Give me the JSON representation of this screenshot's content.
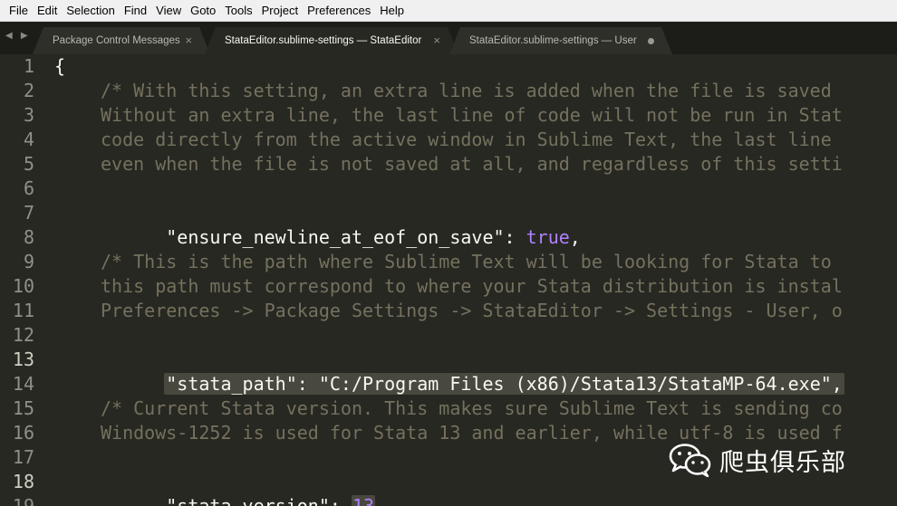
{
  "menu": [
    "File",
    "Edit",
    "Selection",
    "Find",
    "View",
    "Goto",
    "Tools",
    "Project",
    "Preferences",
    "Help"
  ],
  "tabs": [
    {
      "label": "Package Control Messages",
      "close": "×"
    },
    {
      "label": "StataEditor.sublime-settings — StataEditor",
      "close": "×"
    },
    {
      "label": "StataEditor.sublime-settings — User"
    }
  ],
  "nav_arrows": "◀ ▶",
  "line_numbers": [
    "1",
    "2",
    "3",
    "4",
    "5",
    "6",
    "7",
    "8",
    "9",
    "10",
    "11",
    "12",
    "13",
    "14",
    "15",
    "16",
    "17",
    "18",
    "19"
  ],
  "code": {
    "l1": "{",
    "l2": "/* With this setting, an extra line is added when the file is saved",
    "l3": "Without an extra line, the last line of code will not be run in Stat",
    "l4": "code directly from the active window in Sublime Text, the last line",
    "l5": "even when the file is not saved at all, and regardless of this setti",
    "l7_key": "\"ensure_newline_at_eof_on_save\"",
    "l7_sep": ": ",
    "l7_val": "true",
    "l7_end": ",",
    "l9": "/* This is the path where Sublime Text will be looking for Stata to",
    "l10": "this path must correspond to where your Stata distribution is instal",
    "l11": "Preferences -> Package Settings -> StataEditor -> Settings - User, o",
    "l13_key": "\"stata_path\"",
    "l13_sep": ": ",
    "l13_val": "\"C:/Program Files (x86)/Stata13/StataMP-64.exe\"",
    "l13_end": ",",
    "l15": "/* Current Stata version. This makes sure Sublime Text is sending co",
    "l16": "Windows-1252 is used for Stata 13 and earlier, while utf-8 is used f",
    "l18_key": "\"stata_version\"",
    "l18_sep": ": ",
    "l18_val": "13",
    "l18_end": ","
  },
  "watermark": {
    "text": "爬虫俱乐部",
    "icon": "wechat-icon"
  },
  "colors": {
    "background": "#272822",
    "comment": "#75715e",
    "string": "#e6db74",
    "constant": "#ae81ff",
    "text": "#f8f8f2",
    "selection": "#49483e"
  }
}
